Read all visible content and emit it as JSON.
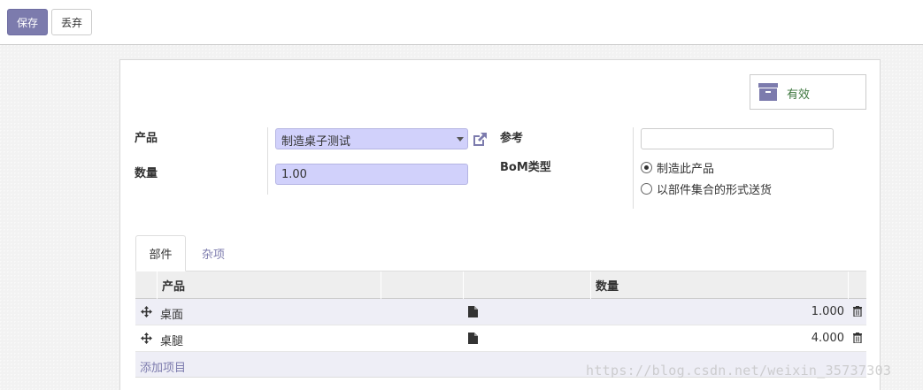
{
  "toolbar": {
    "save_label": "保存",
    "discard_label": "丢弃"
  },
  "status": {
    "active_label": "有效",
    "active_color": "#3c763d"
  },
  "form": {
    "product_label": "产品",
    "product_value": "制造桌子测试",
    "quantity_label": "数量",
    "quantity_value": "1.00",
    "reference_label": "参考",
    "reference_value": "",
    "bom_type_label": "BoM类型",
    "bom_type_options": [
      {
        "label": "制造此产品",
        "selected": true
      },
      {
        "label": "以部件集合的形式送货",
        "selected": false
      }
    ]
  },
  "tabs": [
    {
      "label": "部件",
      "active": true
    },
    {
      "label": "杂项",
      "active": false
    }
  ],
  "table": {
    "columns": {
      "product": "产品",
      "quantity": "数量"
    },
    "rows": [
      {
        "name": "桌面",
        "quantity": "1.000"
      },
      {
        "name": "桌腿",
        "quantity": "4.000"
      }
    ],
    "add_item_label": "添加项目"
  },
  "watermark": "https://blog.csdn.net/weixin_35737303",
  "colors": {
    "primary": "#7c7bad",
    "field_required": "#d1d1fb"
  },
  "icons": [
    "archive-icon",
    "external-link-icon",
    "caret-down-icon",
    "move-icon",
    "document-icon",
    "trash-icon"
  ]
}
